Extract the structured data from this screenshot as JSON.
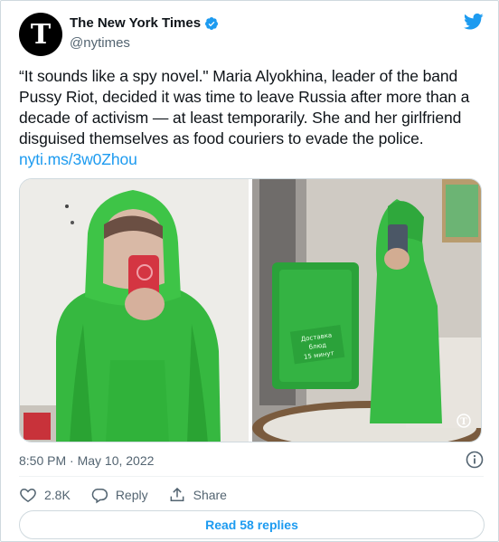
{
  "tweet": {
    "author": {
      "name": "The New York Times",
      "handle": "@nytimes",
      "verified": true,
      "avatar_icon": "nyt-logo-icon"
    },
    "platform_icon": "twitter-bird-icon",
    "text": "“It sounds like a spy novel.\" Maria Alyokhina, leader of the band Pussy Riot, decided it was time to leave Russia after more than a decade of activism — at least temporarily. She and her girlfriend disguised themselves as food couriers to evade the police. ",
    "link": "nyti.ms/3w0Zhou",
    "timestamp": "8:50 PM · May 10, 2022",
    "actions": {
      "likes": "2.8K",
      "reply_label": "Reply",
      "share_label": "Share"
    },
    "read_replies": "Read 58 replies"
  },
  "colors": {
    "accent": "#1d9bf0",
    "text": "#0f1419",
    "muted": "#536471",
    "jacket_green": "#35c63f"
  },
  "media": {
    "left_photo_icon": "photo-woman-green-jacket",
    "right_photo_icon": "photo-courier-backpack",
    "backpack_text": "Доставка блюд 15 минут"
  }
}
